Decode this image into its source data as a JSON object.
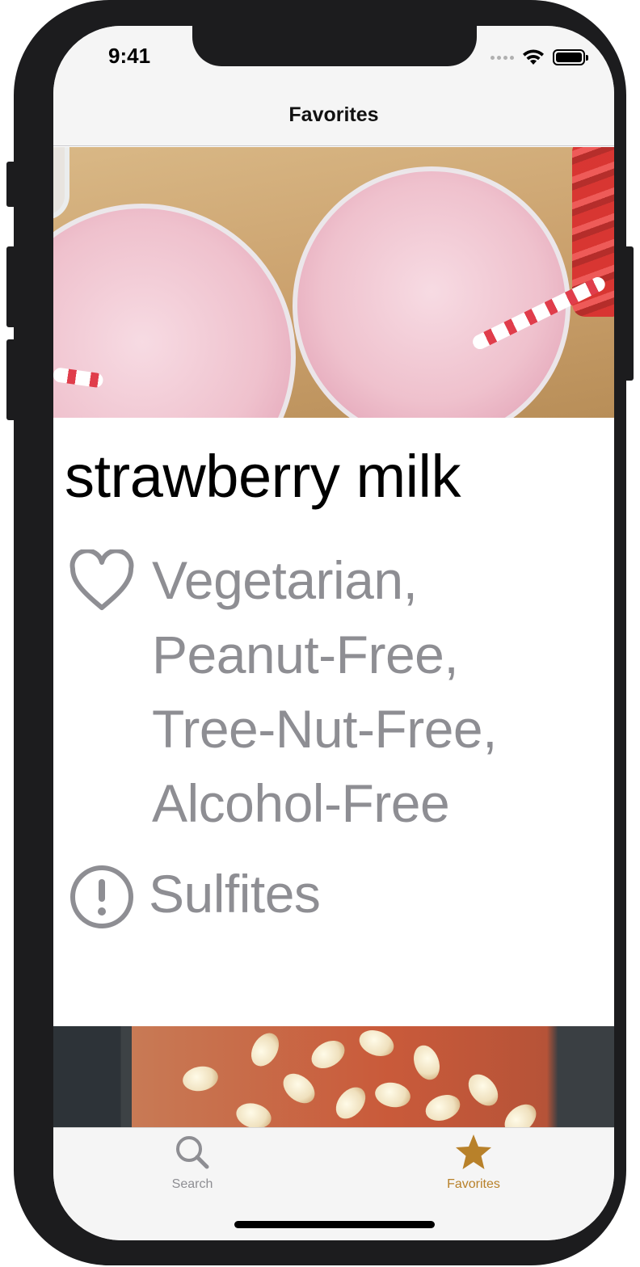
{
  "status_bar": {
    "time": "9:41"
  },
  "nav": {
    "title": "Favorites"
  },
  "recipes": [
    {
      "title": "strawberry milk",
      "health_labels": "Vegetarian,\nPeanut-Free,\nTree-Nut-Free,\nAlcohol-Free",
      "cautions": "Sulfites",
      "icons": {
        "health": "heart-outline-icon",
        "caution": "exclamation-circle-icon"
      }
    }
  ],
  "tabbar": {
    "items": [
      {
        "label": "Search",
        "icon": "search-icon",
        "selected": false
      },
      {
        "label": "Favorites",
        "icon": "star-icon",
        "selected": true
      }
    ],
    "accent": "#b8812a",
    "inactive": "#8e8e93"
  }
}
